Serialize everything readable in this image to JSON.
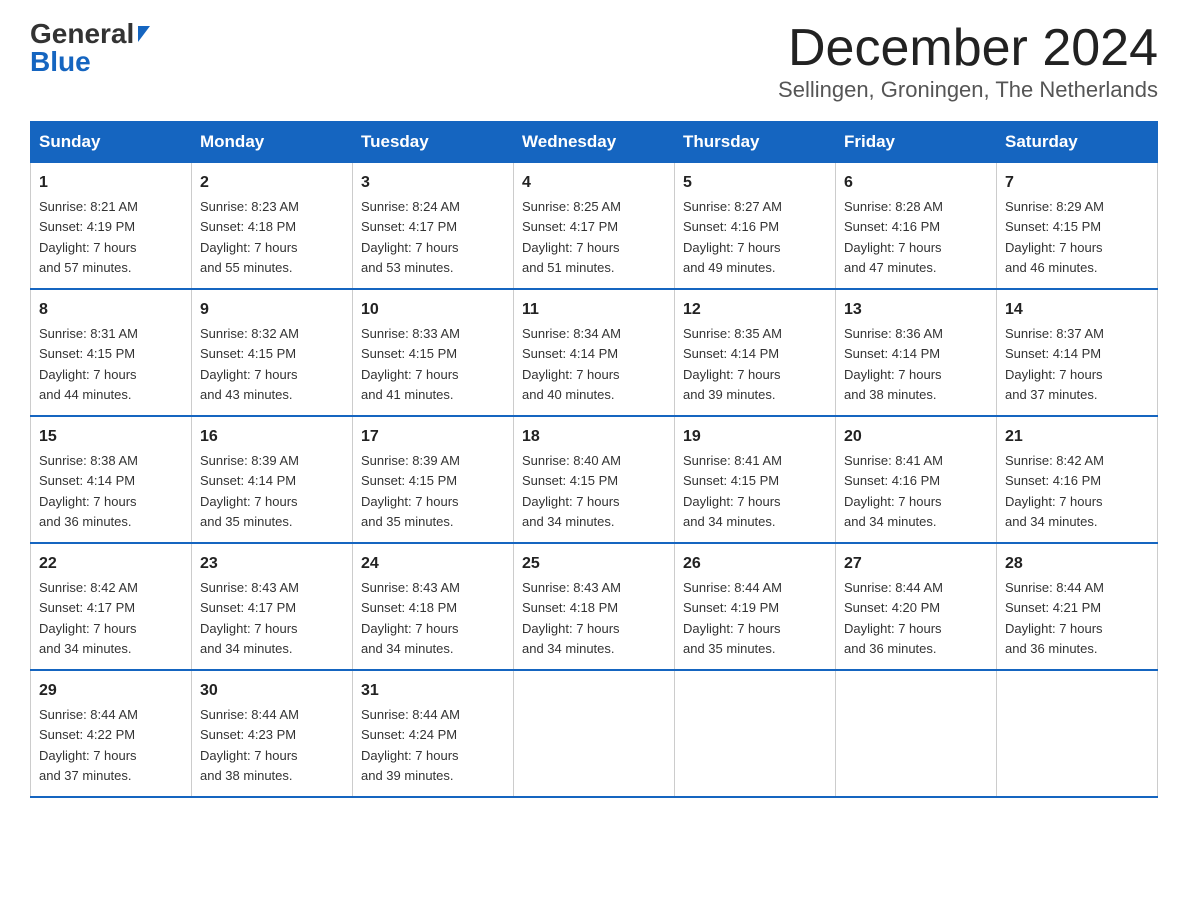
{
  "logo": {
    "general": "General",
    "blue": "Blue"
  },
  "title": "December 2024",
  "location": "Sellingen, Groningen, The Netherlands",
  "days_of_week": [
    "Sunday",
    "Monday",
    "Tuesday",
    "Wednesday",
    "Thursday",
    "Friday",
    "Saturday"
  ],
  "weeks": [
    [
      {
        "day": "1",
        "sunrise": "8:21 AM",
        "sunset": "4:19 PM",
        "daylight": "7 hours and 57 minutes."
      },
      {
        "day": "2",
        "sunrise": "8:23 AM",
        "sunset": "4:18 PM",
        "daylight": "7 hours and 55 minutes."
      },
      {
        "day": "3",
        "sunrise": "8:24 AM",
        "sunset": "4:17 PM",
        "daylight": "7 hours and 53 minutes."
      },
      {
        "day": "4",
        "sunrise": "8:25 AM",
        "sunset": "4:17 PM",
        "daylight": "7 hours and 51 minutes."
      },
      {
        "day": "5",
        "sunrise": "8:27 AM",
        "sunset": "4:16 PM",
        "daylight": "7 hours and 49 minutes."
      },
      {
        "day": "6",
        "sunrise": "8:28 AM",
        "sunset": "4:16 PM",
        "daylight": "7 hours and 47 minutes."
      },
      {
        "day": "7",
        "sunrise": "8:29 AM",
        "sunset": "4:15 PM",
        "daylight": "7 hours and 46 minutes."
      }
    ],
    [
      {
        "day": "8",
        "sunrise": "8:31 AM",
        "sunset": "4:15 PM",
        "daylight": "7 hours and 44 minutes."
      },
      {
        "day": "9",
        "sunrise": "8:32 AM",
        "sunset": "4:15 PM",
        "daylight": "7 hours and 43 minutes."
      },
      {
        "day": "10",
        "sunrise": "8:33 AM",
        "sunset": "4:15 PM",
        "daylight": "7 hours and 41 minutes."
      },
      {
        "day": "11",
        "sunrise": "8:34 AM",
        "sunset": "4:14 PM",
        "daylight": "7 hours and 40 minutes."
      },
      {
        "day": "12",
        "sunrise": "8:35 AM",
        "sunset": "4:14 PM",
        "daylight": "7 hours and 39 minutes."
      },
      {
        "day": "13",
        "sunrise": "8:36 AM",
        "sunset": "4:14 PM",
        "daylight": "7 hours and 38 minutes."
      },
      {
        "day": "14",
        "sunrise": "8:37 AM",
        "sunset": "4:14 PM",
        "daylight": "7 hours and 37 minutes."
      }
    ],
    [
      {
        "day": "15",
        "sunrise": "8:38 AM",
        "sunset": "4:14 PM",
        "daylight": "7 hours and 36 minutes."
      },
      {
        "day": "16",
        "sunrise": "8:39 AM",
        "sunset": "4:14 PM",
        "daylight": "7 hours and 35 minutes."
      },
      {
        "day": "17",
        "sunrise": "8:39 AM",
        "sunset": "4:15 PM",
        "daylight": "7 hours and 35 minutes."
      },
      {
        "day": "18",
        "sunrise": "8:40 AM",
        "sunset": "4:15 PM",
        "daylight": "7 hours and 34 minutes."
      },
      {
        "day": "19",
        "sunrise": "8:41 AM",
        "sunset": "4:15 PM",
        "daylight": "7 hours and 34 minutes."
      },
      {
        "day": "20",
        "sunrise": "8:41 AM",
        "sunset": "4:16 PM",
        "daylight": "7 hours and 34 minutes."
      },
      {
        "day": "21",
        "sunrise": "8:42 AM",
        "sunset": "4:16 PM",
        "daylight": "7 hours and 34 minutes."
      }
    ],
    [
      {
        "day": "22",
        "sunrise": "8:42 AM",
        "sunset": "4:17 PM",
        "daylight": "7 hours and 34 minutes."
      },
      {
        "day": "23",
        "sunrise": "8:43 AM",
        "sunset": "4:17 PM",
        "daylight": "7 hours and 34 minutes."
      },
      {
        "day": "24",
        "sunrise": "8:43 AM",
        "sunset": "4:18 PM",
        "daylight": "7 hours and 34 minutes."
      },
      {
        "day": "25",
        "sunrise": "8:43 AM",
        "sunset": "4:18 PM",
        "daylight": "7 hours and 34 minutes."
      },
      {
        "day": "26",
        "sunrise": "8:44 AM",
        "sunset": "4:19 PM",
        "daylight": "7 hours and 35 minutes."
      },
      {
        "day": "27",
        "sunrise": "8:44 AM",
        "sunset": "4:20 PM",
        "daylight": "7 hours and 36 minutes."
      },
      {
        "day": "28",
        "sunrise": "8:44 AM",
        "sunset": "4:21 PM",
        "daylight": "7 hours and 36 minutes."
      }
    ],
    [
      {
        "day": "29",
        "sunrise": "8:44 AM",
        "sunset": "4:22 PM",
        "daylight": "7 hours and 37 minutes."
      },
      {
        "day": "30",
        "sunrise": "8:44 AM",
        "sunset": "4:23 PM",
        "daylight": "7 hours and 38 minutes."
      },
      {
        "day": "31",
        "sunrise": "8:44 AM",
        "sunset": "4:24 PM",
        "daylight": "7 hours and 39 minutes."
      },
      null,
      null,
      null,
      null
    ]
  ],
  "labels": {
    "sunrise": "Sunrise:",
    "sunset": "Sunset:",
    "daylight": "Daylight:"
  }
}
